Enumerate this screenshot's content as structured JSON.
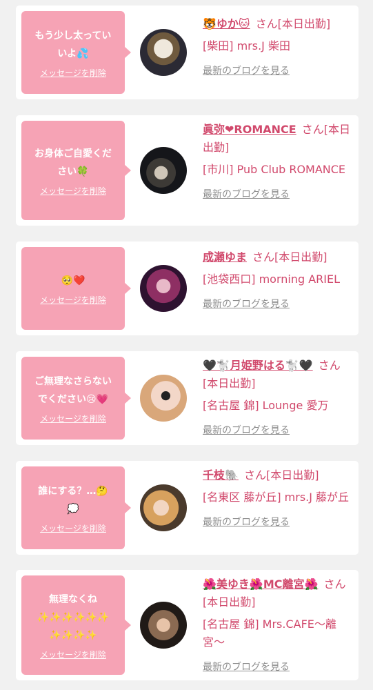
{
  "delete_label": "メッセージを削除",
  "san_suffix": "さん",
  "status": "[本日出勤]",
  "blog_label": "最新のブログを見る",
  "colors": {
    "bubble": "#f6a3b5",
    "link": "#d1496c",
    "muted": "#8e8e8e",
    "bg": "#f1f1f1"
  },
  "cards": [
    {
      "message": "もう少し太ってい\nいよ💦",
      "name": "🐯ゆか🐱",
      "shop": "[柴田] mrs.J 柴田"
    },
    {
      "message": "お身体ご自愛くだ\nさい🍀",
      "name": "眞弥❤ROMANCE",
      "shop": "[市川] Pub Club ROMANCE"
    },
    {
      "message": "🥺❤️",
      "name": "成瀬ゆま",
      "shop": "[池袋西口] morning ARIEL"
    },
    {
      "message": "ご無理なさらない\nでください😢💗",
      "name": "🖤🐩月姫野はる🐩🖤",
      "shop": "[名古屋 錦] Lounge 愛万"
    },
    {
      "message": "誰にする？…🤔\n💭",
      "name": "千枝🐘",
      "shop": "[名東区 藤が丘] mrs.J 藤が丘"
    },
    {
      "message": "無理なくね\n✨✨✨✨✨✨\n✨✨✨✨",
      "name": "🌺美ゆき🌺MC離宮🌺",
      "shop": "[名古屋 錦] Mrs.CAFE〜離宮〜"
    }
  ]
}
